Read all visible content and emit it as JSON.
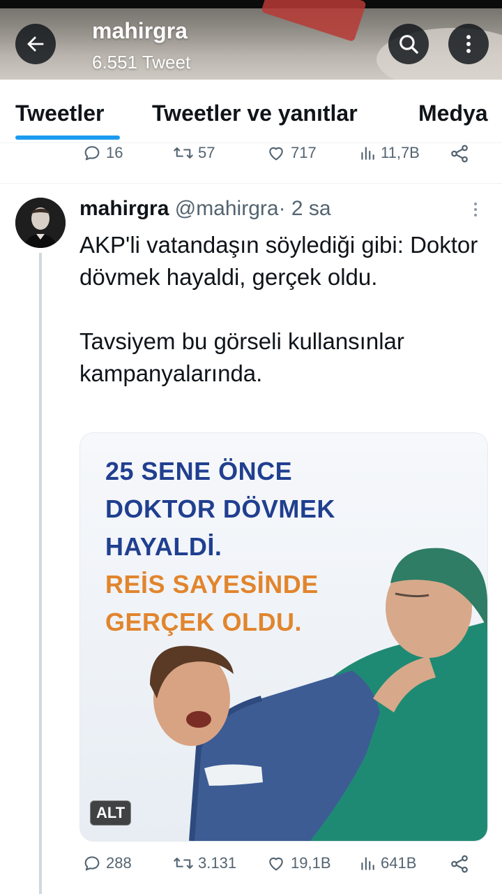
{
  "header": {
    "name": "mahirgra",
    "tweet_count": "6.551 Tweet",
    "back_icon": "arrow-left-icon",
    "search_icon": "search-icon",
    "more_icon": "more-vertical-icon"
  },
  "tabs": [
    {
      "label": "Tweetler",
      "active": true
    },
    {
      "label": "Tweetler ve yanıtlar",
      "active": false
    },
    {
      "label": "Medya",
      "active": false
    }
  ],
  "prev_tweet_actions": {
    "replies": "16",
    "retweets": "57",
    "likes": "717",
    "views": "11,7B"
  },
  "tweet": {
    "name": "mahirgra",
    "handle": "@mahirgra",
    "dot": "·",
    "time": "2 sa",
    "text_lines": [
      "AKP'li vatandaşın söylediği gibi: Doktor dövmek hayaldi, gerçek oldu.",
      "Tavsiyem bu görseli kullansınlar kampanyalarında."
    ],
    "media": {
      "headline_blue": [
        "25 SENE ÖNCE",
        "DOKTOR DÖVMEK",
        "HAYALDİ."
      ],
      "headline_orange": [
        "REİS SAYESİNDE",
        "GERÇEK OLDU."
      ],
      "alt_label": "ALT"
    },
    "actions": {
      "replies": "288",
      "retweets": "3.131",
      "likes": "19,1B",
      "views": "641B"
    }
  },
  "colors": {
    "accent": "#1d9bf0",
    "text": "#0f1419",
    "muted": "#536471",
    "poster_blue": "#203f8f",
    "poster_orange": "#e1852d"
  }
}
